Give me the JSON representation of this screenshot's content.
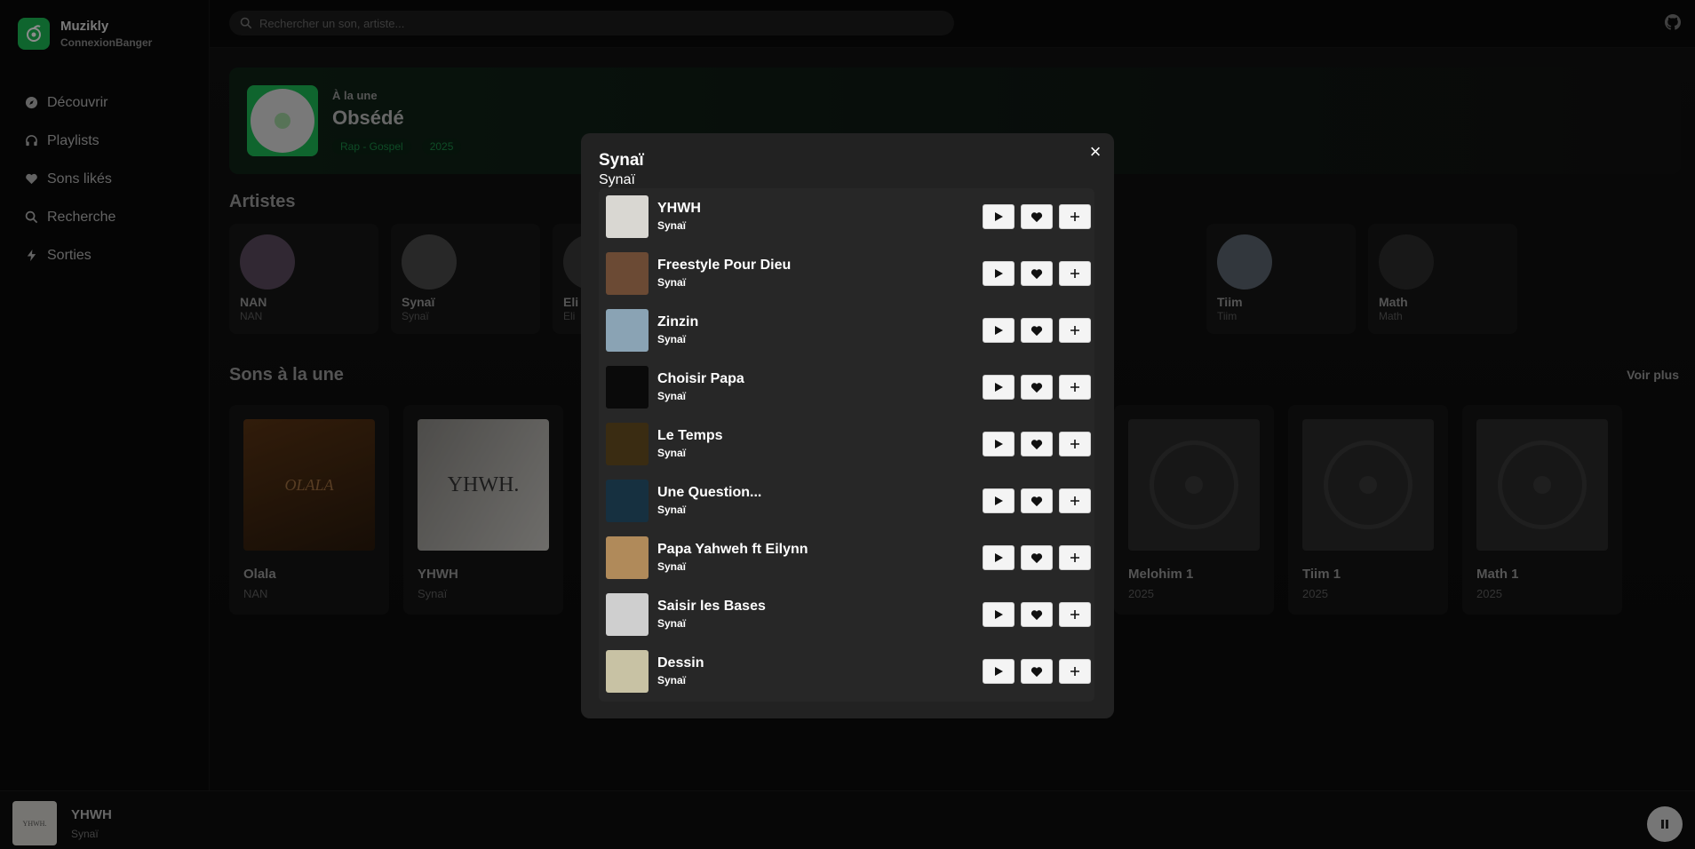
{
  "brand": {
    "name": "Muzikly",
    "user": "ConnexionBanger"
  },
  "nav": [
    {
      "label": "Découvrir",
      "icon": "compass-icon"
    },
    {
      "label": "Playlists",
      "icon": "headphones-icon"
    },
    {
      "label": "Sons likés",
      "icon": "heart-icon"
    },
    {
      "label": "Recherche",
      "icon": "search-icon"
    },
    {
      "label": "Sorties",
      "icon": "bolt-icon"
    }
  ],
  "search": {
    "placeholder": "Rechercher un son, artiste..."
  },
  "feature": {
    "kicker": "À la une",
    "title": "Obsédé",
    "tags": [
      "Rap - Gospel",
      "2025"
    ]
  },
  "sections": {
    "artists": "Artistes",
    "songs": "Sons à la une",
    "see_more": "Voir plus"
  },
  "artists": [
    {
      "name": "NAN",
      "sub": "NAN"
    },
    {
      "name": "Synaï",
      "sub": "Synaï"
    },
    {
      "name": "Eli",
      "sub": "Eli"
    },
    {
      "name": "Tiim",
      "sub": "Tiim"
    },
    {
      "name": "Math",
      "sub": "Math"
    }
  ],
  "songs": [
    {
      "title": "Olala",
      "sub": "NAN",
      "cover_text": "OLALA"
    },
    {
      "title": "YHWH",
      "sub": "Synaï",
      "cover_text": "YHWH."
    },
    {
      "title": "Melohim 1",
      "sub": "2025"
    },
    {
      "title": "Tiim 1",
      "sub": "2025"
    },
    {
      "title": "Math 1",
      "sub": "2025"
    }
  ],
  "player": {
    "title": "YHWH",
    "artist": "Synaï",
    "cover_text": "YHWH."
  },
  "modal": {
    "title": "Synaï",
    "subtitle": "Synaï",
    "close_label": "×",
    "tracks": [
      {
        "title": "YHWH",
        "artist": "Synaï",
        "cover": "#d9d7d2"
      },
      {
        "title": "Freestyle Pour Dieu",
        "artist": "Synaï",
        "cover": "#6b4a34"
      },
      {
        "title": "Zinzin",
        "artist": "Synaï",
        "cover": "#8aa3b4"
      },
      {
        "title": "Choisir Papa",
        "artist": "Synaï",
        "cover": "#0a0a0a"
      },
      {
        "title": "Le Temps",
        "artist": "Synaï",
        "cover": "#3a2c12"
      },
      {
        "title": "Une Question...",
        "artist": "Synaï",
        "cover": "#163040"
      },
      {
        "title": "Papa Yahweh ft Eilynn",
        "artist": "Synaï",
        "cover": "#b08a5a"
      },
      {
        "title": "Saisir les Bases",
        "artist": "Synaï",
        "cover": "#cfcfcf"
      },
      {
        "title": "Dessin",
        "artist": "Synaï",
        "cover": "#c8c2a4"
      }
    ]
  },
  "colors": {
    "accent": "#1db954",
    "modal_bg": "#222222",
    "button_bg": "#f4f4f4"
  }
}
